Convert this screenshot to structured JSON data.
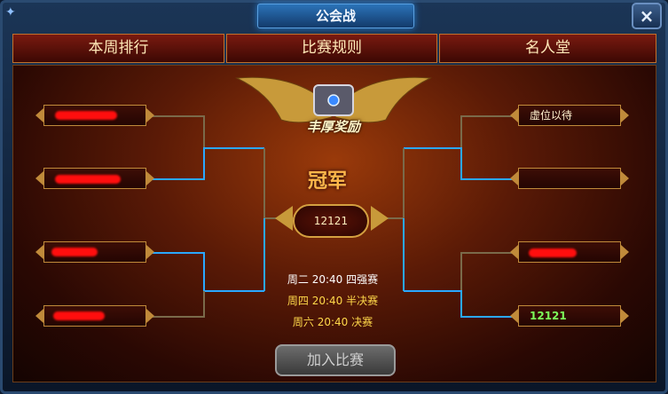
{
  "window": {
    "title": "公会战",
    "close_label": "×"
  },
  "tabs": [
    {
      "label": "本周排行"
    },
    {
      "label": "比赛规则"
    },
    {
      "label": "名人堂"
    }
  ],
  "reward": {
    "label": "丰厚奖励"
  },
  "champion": {
    "label": "冠军",
    "name": "12121"
  },
  "bracket": {
    "left": [
      "",
      "",
      "",
      ""
    ],
    "right": [
      "虚位以待",
      "",
      "",
      "12121"
    ]
  },
  "schedule": [
    {
      "text": "周二 20:40 四强赛",
      "color": "#ffffff"
    },
    {
      "text": "周四 20:40 半决赛",
      "color": "#ffd84a"
    },
    {
      "text": "周六 20:40 决赛",
      "color": "#ffd84a"
    }
  ],
  "join_button": {
    "label": "加入比赛"
  },
  "colors": {
    "highlight_line": "#2aa8ff",
    "dim_line": "#7a6a4a",
    "winner_text": "#7dff5a"
  }
}
